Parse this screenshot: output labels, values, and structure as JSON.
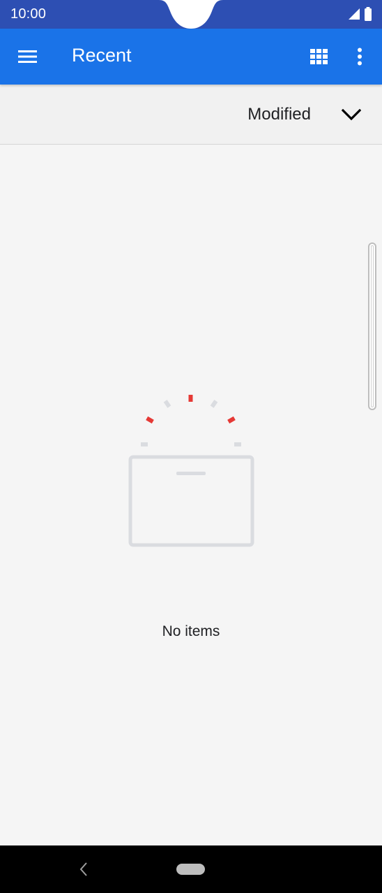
{
  "status_bar": {
    "time": "10:00",
    "icons": [
      "signal-icon",
      "battery-icon"
    ]
  },
  "app_bar": {
    "title": "Recent",
    "menu_icon": "hamburger-menu-icon",
    "grid_icon": "grid-view-icon",
    "more_icon": "more-vertical-icon"
  },
  "sort": {
    "label": "Modified",
    "icon": "chevron-down-icon"
  },
  "empty_state": {
    "message": "No items",
    "icon": "empty-folder-icon"
  },
  "nav_bar": {
    "icons": [
      "back-icon",
      "home-pill-icon"
    ]
  },
  "colors": {
    "status_bar": "#2d4fb3",
    "app_bar": "#1a73e8",
    "background": "#f5f5f5",
    "accent_red": "#e53935",
    "illustration_gray": "#dadce0"
  }
}
